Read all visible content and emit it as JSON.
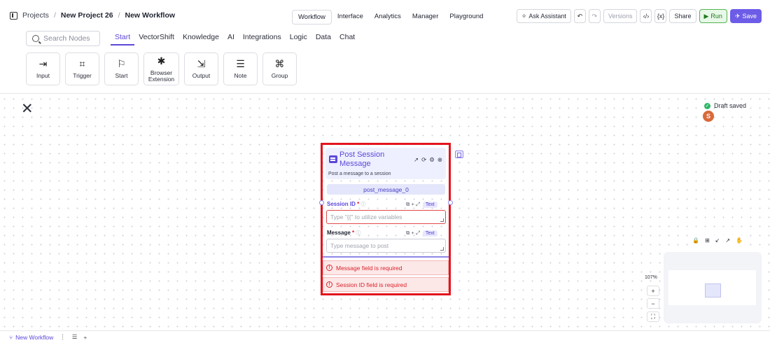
{
  "breadcrumb": {
    "projects": "Projects",
    "separator": "/",
    "project": "New Project 26",
    "workflow": "New Workflow"
  },
  "mode_tabs": [
    {
      "label": "Workflow",
      "active": true
    },
    {
      "label": "Interface",
      "active": false
    },
    {
      "label": "Analytics",
      "active": false
    },
    {
      "label": "Manager",
      "active": false
    },
    {
      "label": "Playground",
      "active": false
    }
  ],
  "actions": {
    "ask_assistant": "Ask Assistant",
    "undo_icon": "↶",
    "redo_icon": "↷",
    "versions": "Versions",
    "code_icon": "‹/›",
    "braces_icon": "{x}",
    "share": "Share",
    "run": "Run",
    "save": "Save"
  },
  "node_bar": {
    "search_placeholder": "Search Nodes",
    "categories": [
      {
        "label": "Start",
        "active": true
      },
      {
        "label": "VectorShift",
        "active": false
      },
      {
        "label": "Knowledge",
        "active": false
      },
      {
        "label": "AI",
        "active": false
      },
      {
        "label": "Integrations",
        "active": false
      },
      {
        "label": "Logic",
        "active": false
      },
      {
        "label": "Data",
        "active": false
      },
      {
        "label": "Chat",
        "active": false
      }
    ],
    "nodes": [
      {
        "label": "Input",
        "icon": "input-icon",
        "glyph": "⇥"
      },
      {
        "label": "Trigger",
        "icon": "crop-trigger-icon",
        "glyph": "⌗"
      },
      {
        "label": "Start",
        "icon": "flag-icon",
        "glyph": "⚐"
      },
      {
        "label": "Browser Extension",
        "icon": "puzzle-icon",
        "glyph": "✱"
      },
      {
        "label": "Output",
        "icon": "output-icon",
        "glyph": "⇲"
      },
      {
        "label": "Note",
        "icon": "note-icon",
        "glyph": "☰"
      },
      {
        "label": "Group",
        "icon": "group-icon",
        "glyph": "⌘"
      }
    ]
  },
  "status": {
    "draft": "Draft saved",
    "avatar_initial": "S"
  },
  "node": {
    "title": "Post Session Message",
    "description": "Post a message to a session",
    "name": "post_message_0",
    "tool_icons": [
      "↗",
      "⟳",
      "⚙",
      "⊗"
    ],
    "fields": [
      {
        "label": "Session ID",
        "required": "*",
        "info": "ⓘ",
        "type_chip": "Text",
        "tools": "⧉ + ⤢",
        "placeholder": "Type \"{{\" to utilize variables",
        "state": "error"
      },
      {
        "label": "Message",
        "required": "*",
        "info": "ⓘ",
        "type_chip": "Text",
        "tools": "⧉ + ⤢",
        "placeholder": "Type message to post",
        "state": "normal"
      }
    ],
    "errors": [
      "Message field is required",
      "Session ID field is required"
    ],
    "error_icon": "!"
  },
  "canvas": {
    "close_glyph": "✕",
    "zoom": "107%",
    "zoom_in": "+",
    "zoom_out": "−",
    "fit": "⛶",
    "map_tools": [
      "🔒",
      "⊞",
      "↙",
      "↗",
      "✋"
    ]
  },
  "bottom": {
    "workflow_tab": "New Workflow",
    "tab_glyph": "⑂",
    "menu_glyph": "⋮",
    "list_glyph": "☰",
    "add_glyph": "+"
  }
}
